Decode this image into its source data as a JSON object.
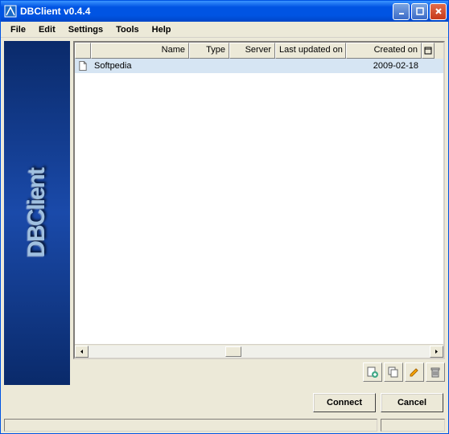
{
  "title": "DBClient v0.4.4",
  "menu": [
    "File",
    "Edit",
    "Settings",
    "Tools",
    "Help"
  ],
  "sidebar_text": "DBClient",
  "columns": {
    "name": "Name",
    "type": "Type",
    "server": "Server",
    "updated": "Last updated on",
    "created": "Created on"
  },
  "rows": [
    {
      "name": "Softpedia",
      "type": "",
      "server": "",
      "updated": "",
      "created": "2009-02-18",
      "selected": true
    }
  ],
  "toolbar_icons": [
    "add-database",
    "copy",
    "edit",
    "delete"
  ],
  "buttons": {
    "connect": "Connect",
    "cancel": "Cancel"
  }
}
